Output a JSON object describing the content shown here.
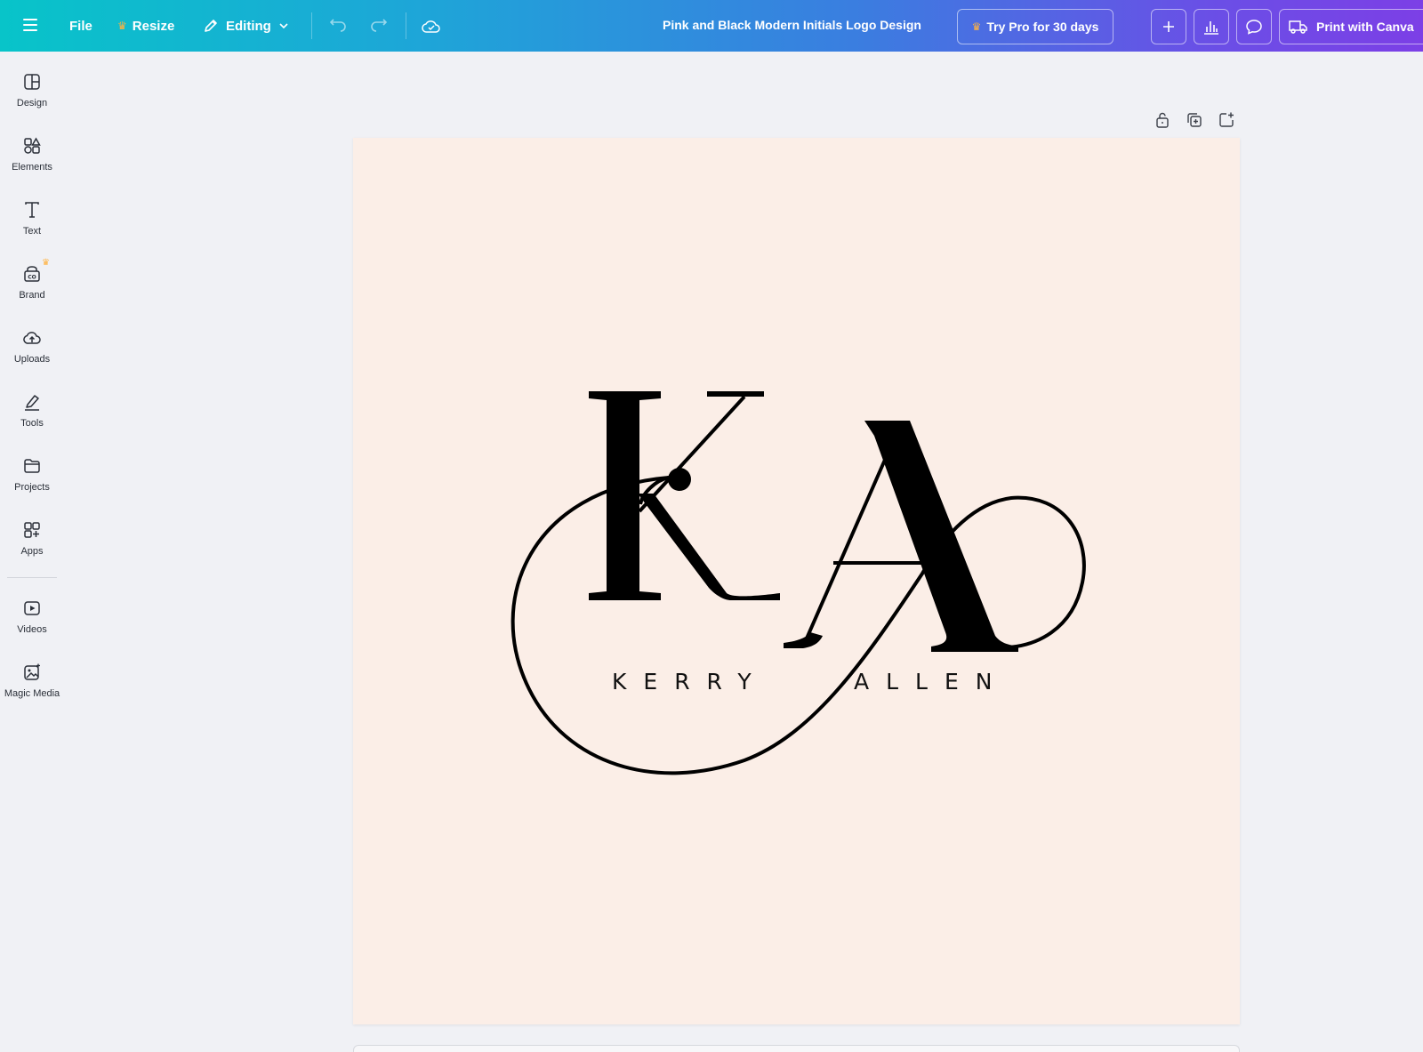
{
  "toolbar": {
    "file_label": "File",
    "resize_label": "Resize",
    "editing_label": "Editing",
    "document_title": "Pink and Black Modern Initials Logo Design",
    "pro_label": "Try Pro for 30 days",
    "print_label": "Print with Canva",
    "accent_colors": [
      "#08c4c9",
      "#3a7ee0",
      "#7c3fe6"
    ],
    "crown_color": "#ffb23f"
  },
  "sidebar": {
    "items": [
      {
        "label": "Design",
        "icon": "design-icon"
      },
      {
        "label": "Elements",
        "icon": "elements-icon"
      },
      {
        "label": "Text",
        "icon": "text-icon"
      },
      {
        "label": "Brand",
        "icon": "brand-icon",
        "pro": true
      },
      {
        "label": "Uploads",
        "icon": "uploads-icon"
      },
      {
        "label": "Tools",
        "icon": "tools-icon"
      },
      {
        "label": "Projects",
        "icon": "projects-icon"
      },
      {
        "label": "Apps",
        "icon": "apps-icon"
      },
      {
        "label": "Videos",
        "icon": "videos-icon"
      },
      {
        "label": "Magic Media",
        "icon": "magic-media-icon"
      }
    ]
  },
  "canvas": {
    "background": "#fbeee7",
    "first_name": "KERRY",
    "last_name": "ALLEN",
    "monogram_left": "K",
    "monogram_right": "A"
  }
}
